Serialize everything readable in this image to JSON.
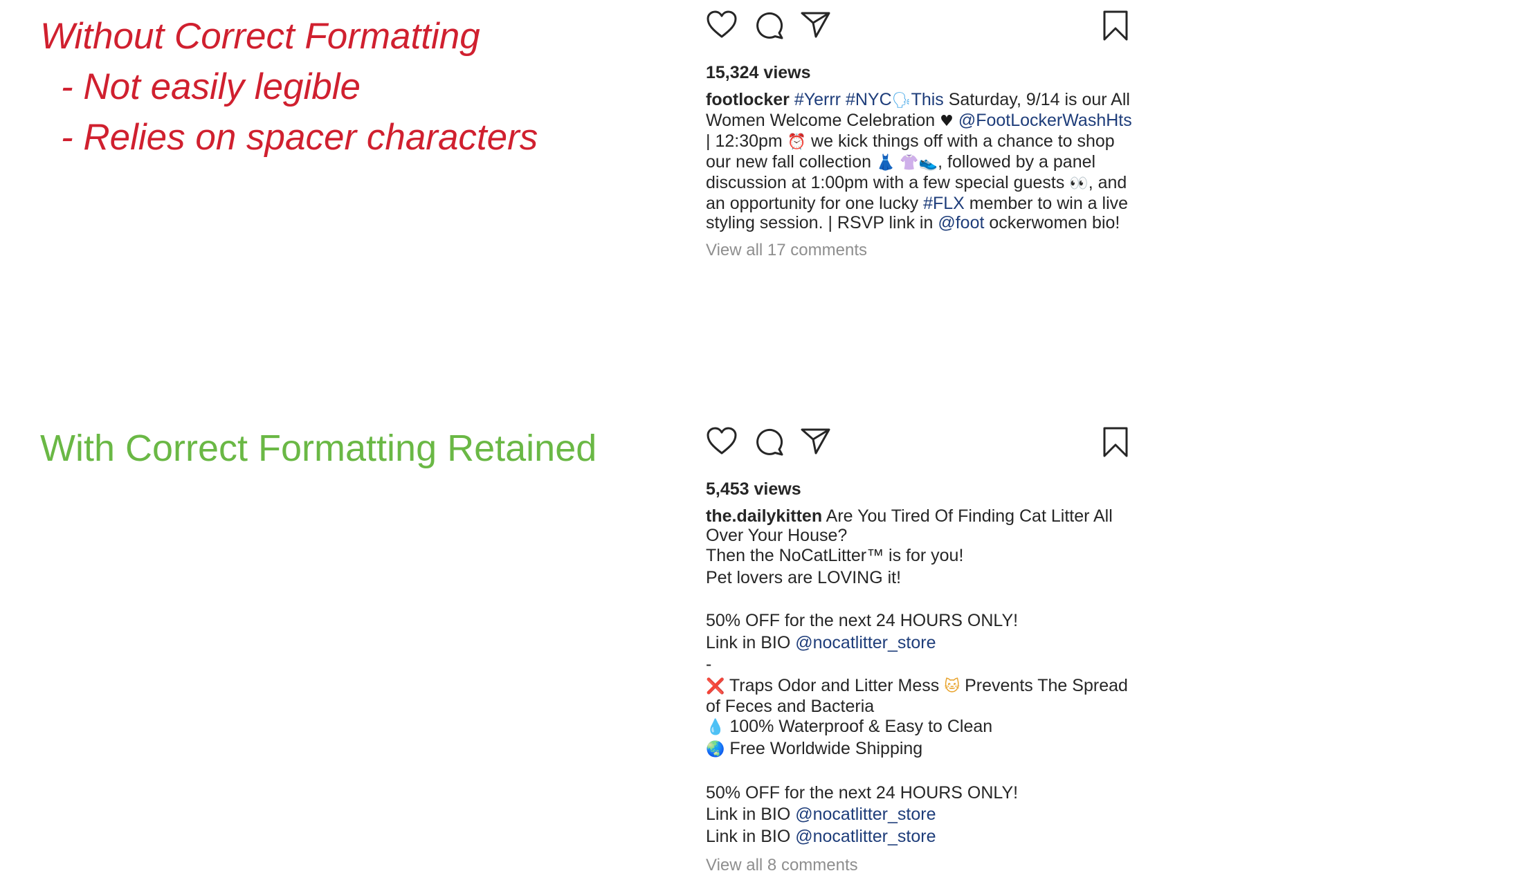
{
  "annotations": {
    "without": {
      "title": "Without Correct Formatting",
      "points": [
        "- Not easily legible",
        "- Relies on spacer characters"
      ]
    },
    "with": {
      "title": "With Correct Formatting Retained"
    }
  },
  "colors": {
    "annotation_red": "#d0202f",
    "annotation_green": "#6ab845",
    "link_blue": "#1e3d7a",
    "muted_gray": "#8e8e8e",
    "text": "#262626"
  },
  "icons": [
    "heart-icon",
    "comment-icon",
    "share-icon",
    "bookmark-icon"
  ],
  "post1": {
    "views": "15,324 views",
    "username": "footlocker",
    "caption": [
      {
        "t": "link",
        "v": "#Yerrr"
      },
      {
        "t": "text",
        "v": " "
      },
      {
        "t": "link",
        "v": "#NYC"
      },
      {
        "t": "emoji",
        "v": "🗣",
        "c": "em-blue"
      },
      {
        "t": "link",
        "v": "This"
      },
      {
        "t": "text",
        "v": " Saturday, 9/14 is our All Women Welcome Celebration "
      },
      {
        "t": "emoji",
        "v": "♥",
        "c": "em-black"
      },
      {
        "t": "text",
        "v": " "
      },
      {
        "t": "link",
        "v": "@FootLockerWashHts"
      },
      {
        "t": "text",
        "v": " | 12:30pm "
      },
      {
        "t": "emoji",
        "v": "⏰",
        "c": "em-brown"
      },
      {
        "t": "text",
        "v": " we kick things off with a chance to shop our new fall collection "
      },
      {
        "t": "emoji",
        "v": "👗",
        "c": "em-teal"
      },
      {
        "t": "text",
        "v": " "
      },
      {
        "t": "emoji",
        "v": "👚",
        "c": "em-pink"
      },
      {
        "t": "emoji",
        "v": "👟",
        "c": "em-grey"
      },
      {
        "t": "text",
        "v": ", followed by a panel discussion at 1:00pm with a few special guests "
      },
      {
        "t": "emoji",
        "v": "👀",
        "c": "em-black"
      },
      {
        "t": "text",
        "v": ", and an opportunity for one lucky "
      },
      {
        "t": "link",
        "v": "#FLX"
      },
      {
        "t": "text",
        "v": " member to win a live styling session. | RSVP link in "
      },
      {
        "t": "link",
        "v": "@foot"
      },
      {
        "t": "text",
        "v": " ockerwomen bio!"
      }
    ],
    "view_comments": "View all 17 comments"
  },
  "post2": {
    "views": "5,453 views",
    "username": "the.dailykitten",
    "line1": "Are You Tired Of Finding Cat Litter All Over Your House?",
    "line2": "Then the NoCatLitter™ is for you!",
    "line3": "Pet lovers are LOVING it!",
    "offer": "50% OFF for the next 24 HOURS ONLY!",
    "bio_prefix": "Link in BIO ",
    "store_handle": "@nocatlitter_store",
    "dash": "-",
    "feature1_emoji": "❌",
    "feature1_a": "Traps Odor and Litter Mess",
    "feature1_emoji2": "🐱",
    "feature1_b": "Prevents The Spread of Feces and Bacteria",
    "feature2_emoji": "💧",
    "feature2": "100% Waterproof & Easy to Clean",
    "feature3_emoji": "🌏",
    "feature3": "Free Worldwide Shipping",
    "offer2": "50% OFF for the next 24 HOURS ONLY!",
    "view_comments": "View all 8 comments"
  }
}
